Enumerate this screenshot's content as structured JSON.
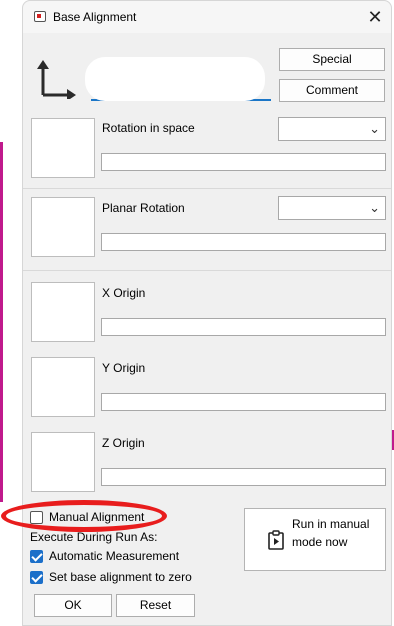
{
  "window": {
    "title": "Base Alignment",
    "close_glyph": "✕",
    "icon": "window-app-icon"
  },
  "header": {
    "special_label": "Special",
    "comment_label": "Comment",
    "name_value": ""
  },
  "rotation_in_space": {
    "label": "Rotation in space",
    "value": "",
    "combo_value": ""
  },
  "planar_rotation": {
    "label": "Planar Rotation",
    "value": "",
    "combo_value": ""
  },
  "x_origin": {
    "label": "X Origin",
    "value": ""
  },
  "y_origin": {
    "label": "Y Origin",
    "value": ""
  },
  "z_origin": {
    "label": "Z Origin",
    "value": ""
  },
  "options": {
    "manual_alignment": {
      "label": "Manual Alignment",
      "checked": false
    },
    "execute_label": "Execute During Run As:",
    "automatic_measurement": {
      "label": "Automatic Measurement",
      "checked": true
    },
    "set_zero": {
      "label": "Set base alignment to zero",
      "checked": true
    }
  },
  "run_manual": {
    "line1": "Run in manual",
    "line2": "mode now"
  },
  "footer": {
    "ok_label": "OK",
    "reset_label": "Reset"
  },
  "colors": {
    "accent": "#1b6fc9",
    "annotation": "#e81d1d",
    "page_edge": "#c0198c"
  }
}
